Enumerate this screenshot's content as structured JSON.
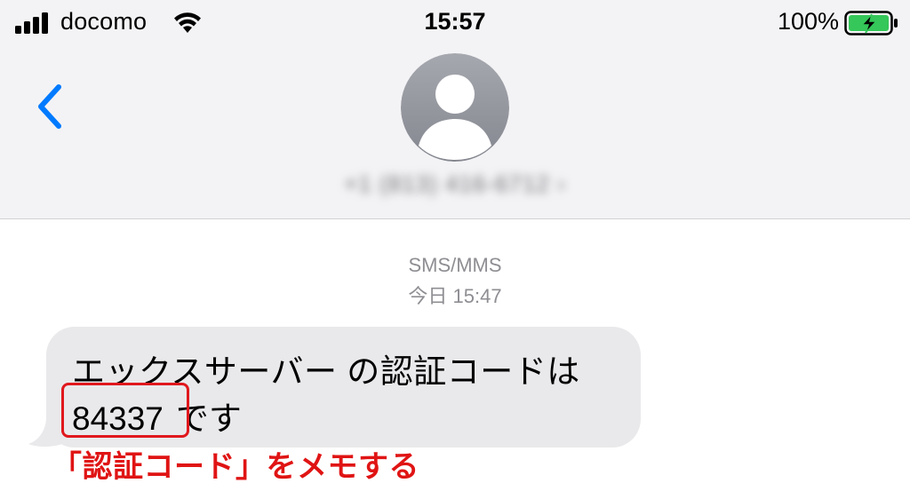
{
  "status_bar": {
    "carrier": "docomo",
    "time": "15:57",
    "battery_percent": "100%",
    "signal_icon": "cellular-signal-icon",
    "wifi_icon": "wifi-icon",
    "battery_icon": "battery-charging-icon"
  },
  "header": {
    "back_icon": "chevron-left-icon",
    "avatar_icon": "person-icon",
    "contact_name": "+1 (813) 416-6712 ›",
    "accent_color": "#007aff"
  },
  "thread": {
    "service": "SMS/MMS",
    "timestamp": "今日 15:47"
  },
  "message": {
    "line1": "エックスサーバー の認証コードは",
    "code": "84337",
    "suffix": "です",
    "bubble_color": "#e9e9eb"
  },
  "annotation": {
    "text": "「認証コード」をメモする",
    "color": "#e01414"
  }
}
